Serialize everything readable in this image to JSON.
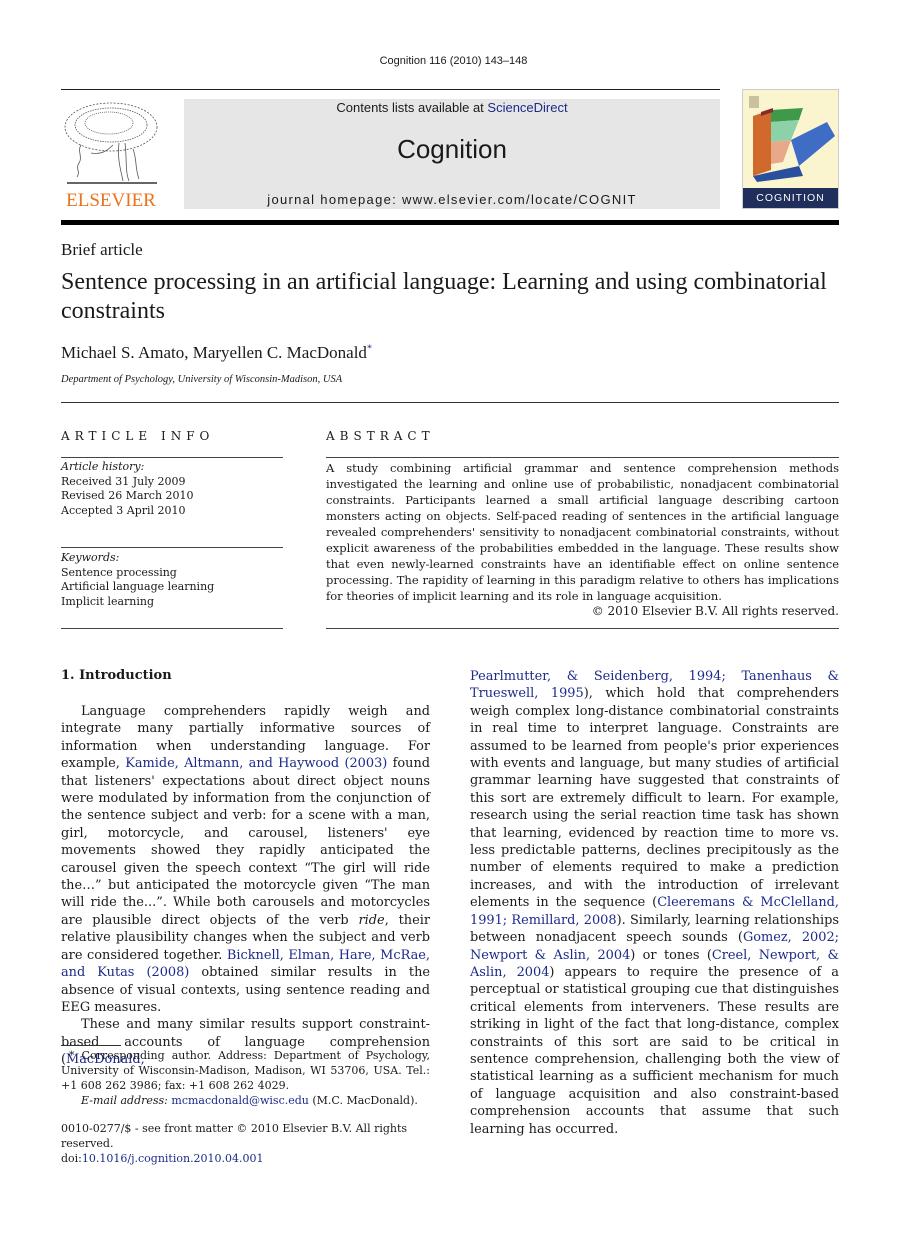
{
  "header": {
    "running_head": "Cognition 116 (2010) 143–148",
    "contents_prefix": "Contents lists available at ",
    "contents_link": "ScienceDirect",
    "journal_name": "Cognition",
    "homepage": "journal homepage: www.elsevier.com/locate/COGNIT",
    "publisher_logo_text": "ELSEVIER",
    "cover_title": "COGNITION",
    "colors": {
      "publisher_orange": "#e8731c",
      "link_blue": "#1c2a8a",
      "banner_gray": "#e6e6e6",
      "cover_navy": "#1f2e5a"
    }
  },
  "article": {
    "type": "Brief article",
    "title": "Sentence processing in an artificial language: Learning and using combinatorial constraints",
    "authors": "Michael S. Amato, Maryellen C. MacDonald",
    "author_mark": "*",
    "affiliation": "Department of Psychology, University of Wisconsin-Madison, USA"
  },
  "article_info": {
    "heading": "ARTICLE INFO",
    "history_label": "Article history:",
    "history": [
      "Received 31 July 2009",
      "Revised 26 March 2010",
      "Accepted 3 April 2010"
    ],
    "keywords_label": "Keywords:",
    "keywords": [
      "Sentence processing",
      "Artificial language learning",
      "Implicit learning"
    ]
  },
  "abstract": {
    "heading": "ABSTRACT",
    "text": "A study combining artificial grammar and sentence comprehension methods investigated the learning and online use of probabilistic, nonadjacent combinatorial constraints. Partic­ipants learned a small artificial language describing cartoon monsters acting on objects. Self-paced reading of sentences in the artificial language revealed comprehenders' sensitiv­ity to nonadjacent combinatorial constraints, without explicit awareness of the probabili­ties embedded in the language. These results show that even newly-learned constraints have an identifiable effect on online sentence processing. The rapidity of learning in this paradigm relative to others has implications for theories of implicit learning and its role in language acquisition.",
    "copyright": "© 2010 Elsevier B.V. All rights reserved."
  },
  "body": {
    "section_heading": "1. Introduction",
    "left": {
      "p1_a": "Language comprehenders rapidly weigh and integrate many partially informative sources of information when understanding language. For example, ",
      "p1_link1": "Kamide, Altmann, and Haywood (2003)",
      "p1_b": " found that listeners' expectations about direct object nouns were modulated by information from the conjunction of the sentence subject and verb: for a scene with a man, girl, motorcycle, and carousel, listen­ers' eye movements showed they rapidly anticipated the carousel given the speech context “The girl will ride the…” but anticipated the motorcycle given “The man will ride the...”. While both carousels and motorcycles are plausible direct objects of the verb ",
      "p1_italic": "ride",
      "p1_c": ", their relative plausibility changes when the subject and verb are considered to­gether. ",
      "p1_link2": "Bicknell, Elman, Hare, McRae, and Kutas (2008)",
      "p1_d": " ob­tained similar results in the absence of visual contexts, using sentence reading and EEG measures.",
      "p2_a": "These and many similar results support constraint-based accounts of language comprehension (",
      "p2_link": "MacDonald,"
    },
    "right": {
      "p2_link_cont": "Pearlmutter, & Seidenberg, 1994; Tanenhaus & Trueswell, 1995",
      "p2_b": "), which hold that comprehenders weigh complex long-distance combinatorial constraints in real time to interpret language. Constraints are assumed to be learned from people's prior experiences with events and language, but many studies of artificial grammar learning have sug­gested that constraints of this sort are extremely difficult to learn. For example, research using the serial reaction time task has shown that learning, evidenced by reaction time to more vs. less predictable patterns, declines precip­itously as the number of elements required to make a pre­diction increases, and with the introduction of irrelevant elements in the sequence (",
      "p2_link2": "Cleeremans & McClelland, 1991; Remillard, 2008",
      "p2_c": "). Similarly, learning relationships between nonadjacent speech sounds (",
      "p2_link3": "Gomez, 2002; New­port & Aslin, 2004",
      "p2_d": ") or tones (",
      "p2_link4": "Creel, Newport, & Aslin, 2004",
      "p2_e": ") appears to require the presence of a perceptual or statistical grouping cue that distinguishes critical elements from interveners. These results are striking in light of the fact that long-distance, complex constraints of this sort are said to be critical in sentence comprehension, challeng­ing both the view of statistical learning as a sufficient mechanism for much of language acquisition and also con­straint-based comprehension accounts that assume that such learning has occurred."
    }
  },
  "footnote": {
    "mark": "*",
    "text": " Corresponding author. Address: Department of Psychology, Univer­sity of Wisconsin-Madison, Madison, WI 53706, USA. Tel.: +1 608 262 3986; fax: +1 608 262 4029.",
    "email_label": "E-mail address:",
    "email": "mcmacdonald@wisc.edu",
    "email_suffix": " (M.C. MacDonald)."
  },
  "front_matter": {
    "issn_line": "0010-0277/$ - see front matter © 2010 Elsevier B.V. All rights reserved.",
    "doi_prefix": "doi:",
    "doi": "10.1016/j.cognition.2010.04.001"
  }
}
